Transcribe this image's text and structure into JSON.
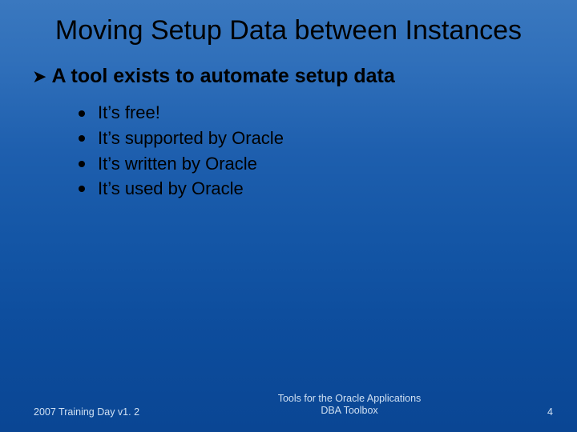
{
  "title": "Moving Setup Data between Instances",
  "main_bullet": "A tool exists to automate setup data",
  "sub_bullets": [
    "It’s free!",
    "It’s supported by Oracle",
    "It’s written by Oracle",
    "It’s used by Oracle"
  ],
  "footer": {
    "left": "2007 Training Day v1. 2",
    "center_line1": "Tools for the Oracle Applications",
    "center_line2": "DBA Toolbox",
    "page": "4"
  }
}
